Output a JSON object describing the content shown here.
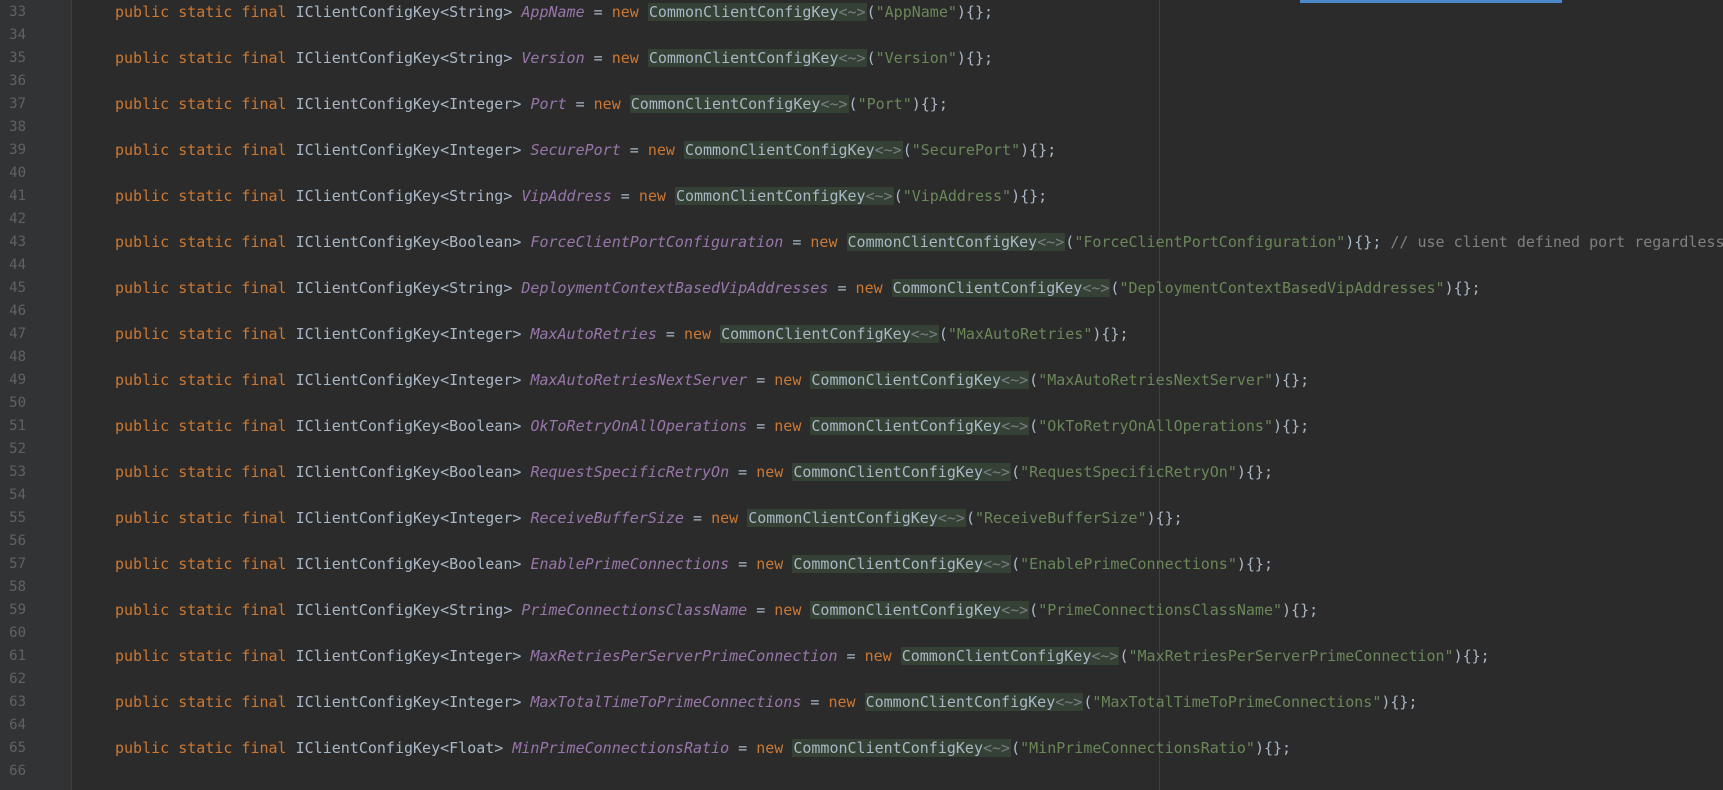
{
  "editor": {
    "theme": {
      "background": "#2b2b2b",
      "keyword": "#cc7832",
      "field": "#9876aa",
      "string": "#6a8759",
      "comment": "#808080",
      "highlight": "#344134",
      "line_number": "#606366"
    },
    "lines": [
      {
        "num": "33",
        "empty": false,
        "mods": "public static final",
        "type": "IClientConfigKey<String>",
        "name": "AppName",
        "assign": "= new",
        "cls": "CommonClientConfigKey",
        "diamond": "<~>",
        "open": "(",
        "str": "\"AppName\"",
        "close": "){};",
        "comment": ""
      },
      {
        "num": "34",
        "empty": true
      },
      {
        "num": "35",
        "empty": false,
        "mods": "public static final",
        "type": "IClientConfigKey<String>",
        "name": "Version",
        "assign": "= new",
        "cls": "CommonClientConfigKey",
        "diamond": "<~>",
        "open": "(",
        "str": "\"Version\"",
        "close": "){};",
        "comment": ""
      },
      {
        "num": "36",
        "empty": true
      },
      {
        "num": "37",
        "empty": false,
        "mods": "public static final",
        "type": "IClientConfigKey<Integer>",
        "name": "Port",
        "assign": "= new",
        "cls": "CommonClientConfigKey",
        "diamond": "<~>",
        "open": "(",
        "str": "\"Port\"",
        "close": "){};",
        "comment": ""
      },
      {
        "num": "38",
        "empty": true
      },
      {
        "num": "39",
        "empty": false,
        "mods": "public static final",
        "type": "IClientConfigKey<Integer>",
        "name": "SecurePort",
        "assign": "= new",
        "cls": "CommonClientConfigKey",
        "diamond": "<~>",
        "open": "(",
        "str": "\"SecurePort\"",
        "close": "){};",
        "comment": ""
      },
      {
        "num": "40",
        "empty": true
      },
      {
        "num": "41",
        "empty": false,
        "mods": "public static final",
        "type": "IClientConfigKey<String>",
        "name": "VipAddress",
        "assign": "= new",
        "cls": "CommonClientConfigKey",
        "diamond": "<~>",
        "open": "(",
        "str": "\"VipAddress\"",
        "close": "){};",
        "comment": ""
      },
      {
        "num": "42",
        "empty": true
      },
      {
        "num": "43",
        "empty": false,
        "mods": "public static final",
        "type": "IClientConfigKey<Boolean>",
        "name": "ForceClientPortConfiguration",
        "assign": "= new",
        "cls": "CommonClientConfigKey",
        "diamond": "<~>",
        "open": "(",
        "str": "\"ForceClientPortConfiguration\"",
        "close": "){};",
        "comment": "// use client defined port regardless"
      },
      {
        "num": "44",
        "empty": true
      },
      {
        "num": "45",
        "empty": false,
        "mods": "public static final",
        "type": "IClientConfigKey<String>",
        "name": "DeploymentContextBasedVipAddresses",
        "assign": "= new",
        "cls": "CommonClientConfigKey",
        "diamond": "<~>",
        "open": "(",
        "str": "\"DeploymentContextBasedVipAddresses\"",
        "close": "){};",
        "comment": ""
      },
      {
        "num": "46",
        "empty": true
      },
      {
        "num": "47",
        "empty": false,
        "mods": "public static final",
        "type": "IClientConfigKey<Integer>",
        "name": "MaxAutoRetries",
        "assign": "= new",
        "cls": "CommonClientConfigKey",
        "diamond": "<~>",
        "open": "(",
        "str": "\"MaxAutoRetries\"",
        "close": "){};",
        "comment": ""
      },
      {
        "num": "48",
        "empty": true
      },
      {
        "num": "49",
        "empty": false,
        "mods": "public static final",
        "type": "IClientConfigKey<Integer>",
        "name": "MaxAutoRetriesNextServer",
        "assign": "= new",
        "cls": "CommonClientConfigKey",
        "diamond": "<~>",
        "open": "(",
        "str": "\"MaxAutoRetriesNextServer\"",
        "close": "){};",
        "comment": ""
      },
      {
        "num": "50",
        "empty": true
      },
      {
        "num": "51",
        "empty": false,
        "mods": "public static final",
        "type": "IClientConfigKey<Boolean>",
        "name": "OkToRetryOnAllOperations",
        "assign": "= new",
        "cls": "CommonClientConfigKey",
        "diamond": "<~>",
        "open": "(",
        "str": "\"OkToRetryOnAllOperations\"",
        "close": "){};",
        "comment": ""
      },
      {
        "num": "52",
        "empty": true
      },
      {
        "num": "53",
        "empty": false,
        "mods": "public static final",
        "type": "IClientConfigKey<Boolean>",
        "name": "RequestSpecificRetryOn",
        "assign": "= new",
        "cls": "CommonClientConfigKey",
        "diamond": "<~>",
        "open": "(",
        "str": "\"RequestSpecificRetryOn\"",
        "close": "){};",
        "comment": ""
      },
      {
        "num": "54",
        "empty": true
      },
      {
        "num": "55",
        "empty": false,
        "mods": "public static final",
        "type": "IClientConfigKey<Integer>",
        "name": "ReceiveBufferSize",
        "assign": "= new",
        "cls": "CommonClientConfigKey",
        "diamond": "<~>",
        "open": "(",
        "str": "\"ReceiveBufferSize\"",
        "close": "){};",
        "comment": ""
      },
      {
        "num": "56",
        "empty": true
      },
      {
        "num": "57",
        "empty": false,
        "mods": "public static final",
        "type": "IClientConfigKey<Boolean>",
        "name": "EnablePrimeConnections",
        "assign": "= new",
        "cls": "CommonClientConfigKey",
        "diamond": "<~>",
        "open": "(",
        "str": "\"EnablePrimeConnections\"",
        "close": "){};",
        "comment": ""
      },
      {
        "num": "58",
        "empty": true
      },
      {
        "num": "59",
        "empty": false,
        "mods": "public static final",
        "type": "IClientConfigKey<String>",
        "name": "PrimeConnectionsClassName",
        "assign": "= new",
        "cls": "CommonClientConfigKey",
        "diamond": "<~>",
        "open": "(",
        "str": "\"PrimeConnectionsClassName\"",
        "close": "){};",
        "comment": ""
      },
      {
        "num": "60",
        "empty": true
      },
      {
        "num": "61",
        "empty": false,
        "mods": "public static final",
        "type": "IClientConfigKey<Integer>",
        "name": "MaxRetriesPerServerPrimeConnection",
        "assign": "= new",
        "cls": "CommonClientConfigKey",
        "diamond": "<~>",
        "open": "(",
        "str": "\"MaxRetriesPerServerPrimeConnection\"",
        "close": "){};",
        "comment": ""
      },
      {
        "num": "62",
        "empty": true
      },
      {
        "num": "63",
        "empty": false,
        "mods": "public static final",
        "type": "IClientConfigKey<Integer>",
        "name": "MaxTotalTimeToPrimeConnections",
        "assign": "= new",
        "cls": "CommonClientConfigKey",
        "diamond": "<~>",
        "open": "(",
        "str": "\"MaxTotalTimeToPrimeConnections\"",
        "close": "){};",
        "comment": ""
      },
      {
        "num": "64",
        "empty": true
      },
      {
        "num": "65",
        "empty": false,
        "mods": "public static final",
        "type": "IClientConfigKey<Float>",
        "name": "MinPrimeConnectionsRatio",
        "assign": "= new",
        "cls": "CommonClientConfigKey",
        "diamond": "<~>",
        "open": "(",
        "str": "\"MinPrimeConnectionsRatio\"",
        "close": "){};",
        "comment": ""
      },
      {
        "num": "66",
        "empty": true
      }
    ]
  }
}
